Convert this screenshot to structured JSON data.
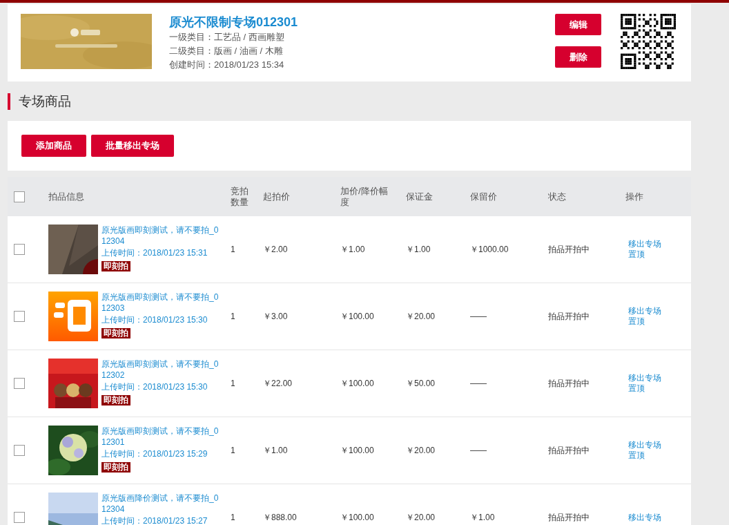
{
  "session": {
    "title": "原光不限制专场012301",
    "meta": [
      {
        "label": "一级类目：",
        "value": "工艺品 / 西画雕塑"
      },
      {
        "label": "二级类目：",
        "value": "版画 / 油画 / 木雕"
      },
      {
        "label": "创建时间：",
        "value": "2018/01/23 15:34"
      }
    ],
    "buttons": [
      "编辑",
      "删除"
    ]
  },
  "section_title": "专场商品",
  "toolbar": [
    "添加商品",
    "批量移出专场"
  ],
  "table": {
    "select_all": {
      "checked": false
    },
    "columns": [
      "拍品信息",
      "竞拍数量",
      "起拍价",
      "加价/降价幅度",
      "保证金",
      "保留价",
      "状态",
      "操作"
    ],
    "rows": [
      {
        "checked": false,
        "title": "原光版画即刻测试，请不要拍_012304",
        "upload_label": "上传时间：",
        "upload_time": "2018/01/23 15:31",
        "tag": "即刻拍",
        "qty": "1",
        "start": "￥2.00",
        "step": "￥1.00",
        "deposit": "￥1.00",
        "reserve": "￥1000.00",
        "status": "拍品开拍中",
        "actions": [
          "移出专场",
          "置顶"
        ]
      },
      {
        "checked": false,
        "title": "原光版画即刻测试，请不要拍_012303",
        "upload_label": "上传时间：",
        "upload_time": "2018/01/23 15:30",
        "tag": "即刻拍",
        "qty": "1",
        "start": "￥3.00",
        "step": "￥100.00",
        "deposit": "￥20.00",
        "reserve": "——",
        "status": "拍品开拍中",
        "actions": [
          "移出专场",
          "置顶"
        ]
      },
      {
        "checked": false,
        "title": "原光版画即刻测试，请不要拍_012302",
        "upload_label": "上传时间：",
        "upload_time": "2018/01/23 15:30",
        "tag": "即刻拍",
        "qty": "1",
        "start": "￥22.00",
        "step": "￥100.00",
        "deposit": "￥50.00",
        "reserve": "——",
        "status": "拍品开拍中",
        "actions": [
          "移出专场",
          "置顶"
        ]
      },
      {
        "checked": false,
        "title": "原光版画即刻测试，请不要拍_012301",
        "upload_label": "上传时间：",
        "upload_time": "2018/01/23 15:29",
        "tag": "即刻拍",
        "qty": "1",
        "start": "￥1.00",
        "step": "￥100.00",
        "deposit": "￥20.00",
        "reserve": "——",
        "status": "拍品开拍中",
        "actions": [
          "移出专场",
          "置顶"
        ]
      },
      {
        "checked": false,
        "title": "原光版画降价测试，请不要拍_012304",
        "upload_label": "上传时间：",
        "upload_time": "2018/01/23 15:27",
        "qty": "1",
        "start": "￥888.00",
        "step": "￥100.00",
        "deposit": "￥20.00",
        "reserve": "￥1.00",
        "status": "拍品开拍中",
        "actions": [
          "移出专场"
        ]
      }
    ]
  }
}
